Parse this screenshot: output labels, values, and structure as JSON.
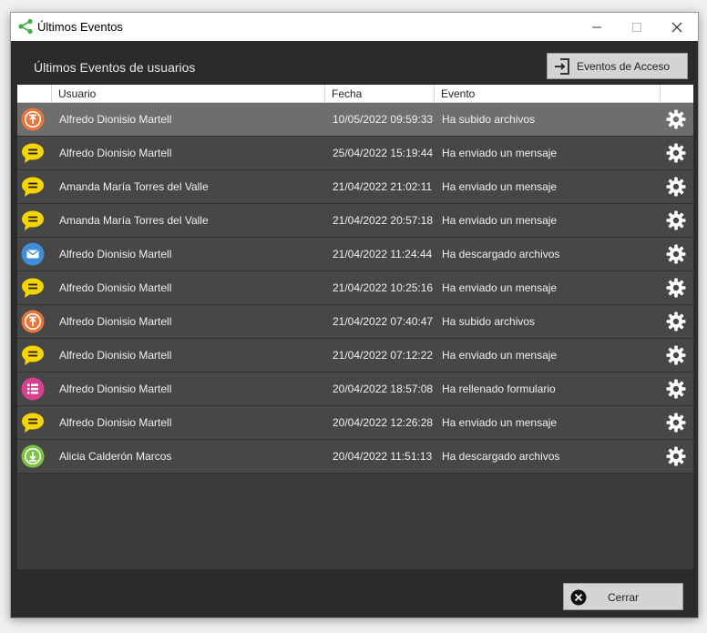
{
  "window": {
    "title": "Últimos Eventos"
  },
  "header": {
    "heading": "Últimos Eventos de usuarios",
    "access_button": "Eventos de Acceso"
  },
  "columns": {
    "user": "Usuario",
    "date": "Fecha",
    "event": "Evento"
  },
  "rows": [
    {
      "icon": "upload",
      "user": "Alfredo Dionisio Martell",
      "date": "10/05/2022 09:59:33",
      "event": "Ha subido archivos",
      "selected": true
    },
    {
      "icon": "message",
      "user": "Alfredo Dionisio Martell",
      "date": "25/04/2022 15:19:44",
      "event": "Ha enviado un mensaje"
    },
    {
      "icon": "message",
      "user": "Amanda María Torres del Valle",
      "date": "21/04/2022 21:02:11",
      "event": "Ha enviado un mensaje"
    },
    {
      "icon": "message",
      "user": "Amanda María Torres del Valle",
      "date": "21/04/2022 20:57:18",
      "event": "Ha enviado un mensaje"
    },
    {
      "icon": "mail",
      "user": "Alfredo Dionisio Martell",
      "date": "21/04/2022 11:24:44",
      "event": "Ha descargado archivos"
    },
    {
      "icon": "message",
      "user": "Alfredo Dionisio Martell",
      "date": "21/04/2022 10:25:16",
      "event": "Ha enviado un mensaje"
    },
    {
      "icon": "upload",
      "user": "Alfredo Dionisio Martell",
      "date": "21/04/2022 07:40:47",
      "event": "Ha subido archivos"
    },
    {
      "icon": "message",
      "user": "Alfredo Dionisio Martell",
      "date": "21/04/2022 07:12:22",
      "event": "Ha enviado un mensaje"
    },
    {
      "icon": "form",
      "user": "Alfredo Dionisio Martell",
      "date": "20/04/2022 18:57:08",
      "event": "Ha rellenado formulario"
    },
    {
      "icon": "message",
      "user": "Alfredo Dionisio Martell",
      "date": "20/04/2022 12:26:28",
      "event": "Ha enviado un mensaje"
    },
    {
      "icon": "download",
      "user": "Alicia Calderón Marcos",
      "date": "20/04/2022 11:51:13",
      "event": "Ha descargado archivos"
    }
  ],
  "footer": {
    "close_button": "Cerrar"
  },
  "colors": {
    "upload": "#e8763a",
    "message": "#f5d400",
    "mail": "#3e8fd8",
    "form": "#d6408c",
    "download": "#7cc242",
    "selected_row": "#6e6e6e",
    "row": "#474747"
  }
}
